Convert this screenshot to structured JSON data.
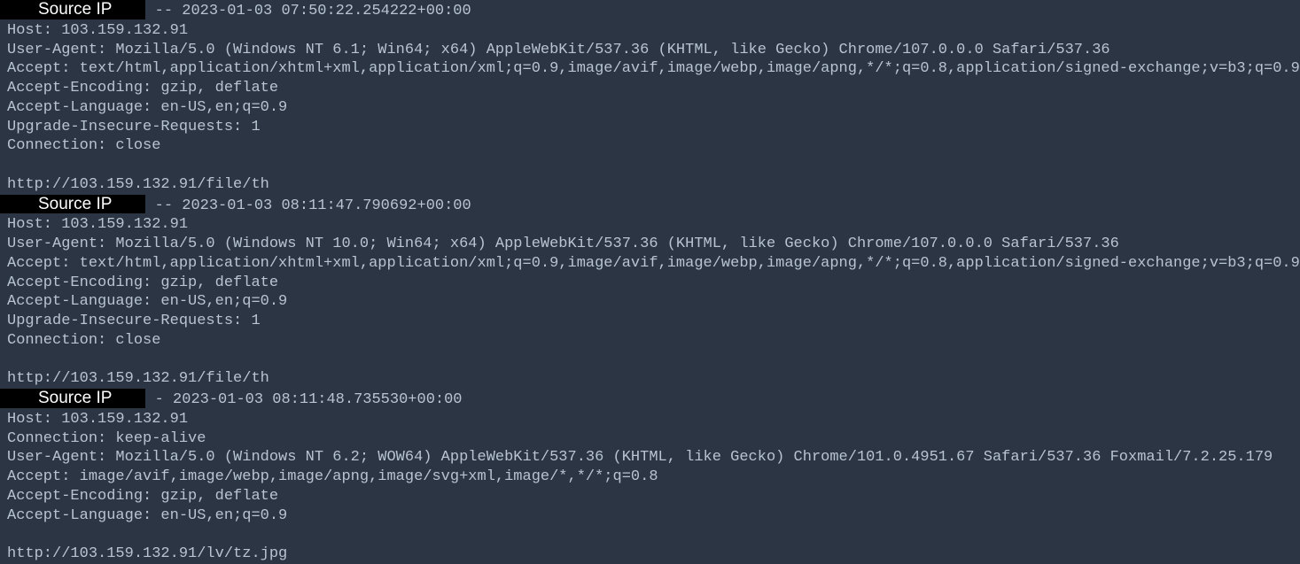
{
  "source_ip_label": "Source IP",
  "entries": [
    {
      "sep": " -- ",
      "timestamp": "2023-01-03 07:50:22.254222+00:00",
      "headers": [
        "Host: 103.159.132.91",
        "User-Agent: Mozilla/5.0 (Windows NT 6.1; Win64; x64) AppleWebKit/537.36 (KHTML, like Gecko) Chrome/107.0.0.0 Safari/537.36",
        "Accept: text/html,application/xhtml+xml,application/xml;q=0.9,image/avif,image/webp,image/apng,*/*;q=0.8,application/signed-exchange;v=b3;q=0.9",
        "Accept-Encoding: gzip, deflate",
        "Accept-Language: en-US,en;q=0.9",
        "Upgrade-Insecure-Requests: 1",
        "Connection: close"
      ],
      "url": "http://103.159.132.91/file/th"
    },
    {
      "sep": " -- ",
      "timestamp": "2023-01-03 08:11:47.790692+00:00",
      "headers": [
        "Host: 103.159.132.91",
        "User-Agent: Mozilla/5.0 (Windows NT 10.0; Win64; x64) AppleWebKit/537.36 (KHTML, like Gecko) Chrome/107.0.0.0 Safari/537.36",
        "Accept: text/html,application/xhtml+xml,application/xml;q=0.9,image/avif,image/webp,image/apng,*/*;q=0.8,application/signed-exchange;v=b3;q=0.9",
        "Accept-Encoding: gzip, deflate",
        "Accept-Language: en-US,en;q=0.9",
        "Upgrade-Insecure-Requests: 1",
        "Connection: close"
      ],
      "url": "http://103.159.132.91/file/th"
    },
    {
      "sep": " - ",
      "timestamp": "2023-01-03 08:11:48.735530+00:00",
      "headers": [
        "Host: 103.159.132.91",
        "Connection: keep-alive",
        "User-Agent: Mozilla/5.0 (Windows NT 6.2; WOW64) AppleWebKit/537.36 (KHTML, like Gecko) Chrome/101.0.4951.67 Safari/537.36 Foxmail/7.2.25.179",
        "Accept: image/avif,image/webp,image/apng,image/svg+xml,image/*,*/*;q=0.8",
        "Accept-Encoding: gzip, deflate",
        "Accept-Language: en-US,en;q=0.9"
      ],
      "url": "http://103.159.132.91/lv/tz.jpg"
    }
  ]
}
